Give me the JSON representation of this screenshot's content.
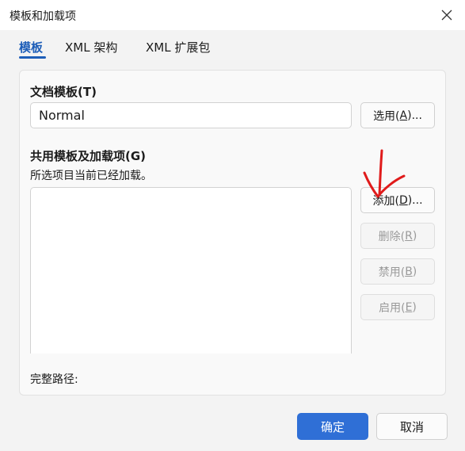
{
  "window": {
    "title": "模板和加载项"
  },
  "tabs": [
    {
      "label": "模板"
    },
    {
      "label": "XML 架构"
    },
    {
      "label": "XML 扩展包"
    }
  ],
  "template_section": {
    "heading": "文档模板(T)",
    "value": "Normal",
    "choose_button": {
      "pre": "选用(",
      "key": "A",
      "post": ")..."
    }
  },
  "addins_section": {
    "heading": "共用模板及加载项(G)",
    "subtitle": "所选项目当前已经加载。",
    "add_button": {
      "pre": "添加(",
      "key": "D",
      "post": ")..."
    },
    "remove_button": {
      "pre": "删除(",
      "key": "R",
      "post": ")"
    },
    "disable_button": {
      "pre": "禁用(",
      "key": "B",
      "post": ")"
    },
    "enable_button": {
      "pre": "启用(",
      "key": "E",
      "post": ")"
    },
    "full_path_label": "完整路径:"
  },
  "footer": {
    "ok": "确定",
    "cancel": "取消"
  },
  "annotation": {
    "color": "#e01b1b"
  }
}
